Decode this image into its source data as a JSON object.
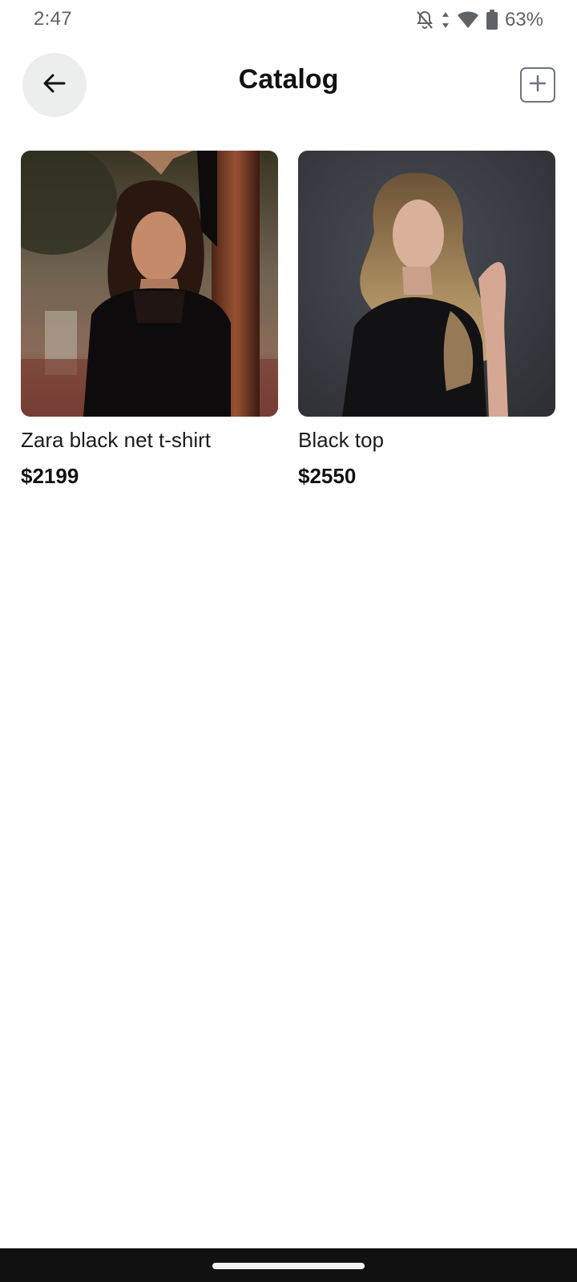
{
  "status_bar": {
    "time": "2:47",
    "battery": "63%",
    "icons": [
      "bell-off-icon",
      "data-arrows-icon",
      "wifi-icon",
      "battery-icon"
    ]
  },
  "header": {
    "title": "Catalog",
    "back_icon": "arrow-left-icon",
    "add_icon": "plus-square-icon"
  },
  "products": [
    {
      "name": "Zara black net t-shirt",
      "price": "$2199",
      "image": "photo of woman with dark wavy hair in black mesh top leaning on wooden post"
    },
    {
      "name": "Black top",
      "price": "$2550",
      "image": "photo of woman with long blonde hair in black sheer top on grey background"
    }
  ],
  "colors": {
    "back_button_bg": "#eceeed",
    "add_border": "#6b7480",
    "text": "#111111",
    "nav_bar": "#111111"
  }
}
